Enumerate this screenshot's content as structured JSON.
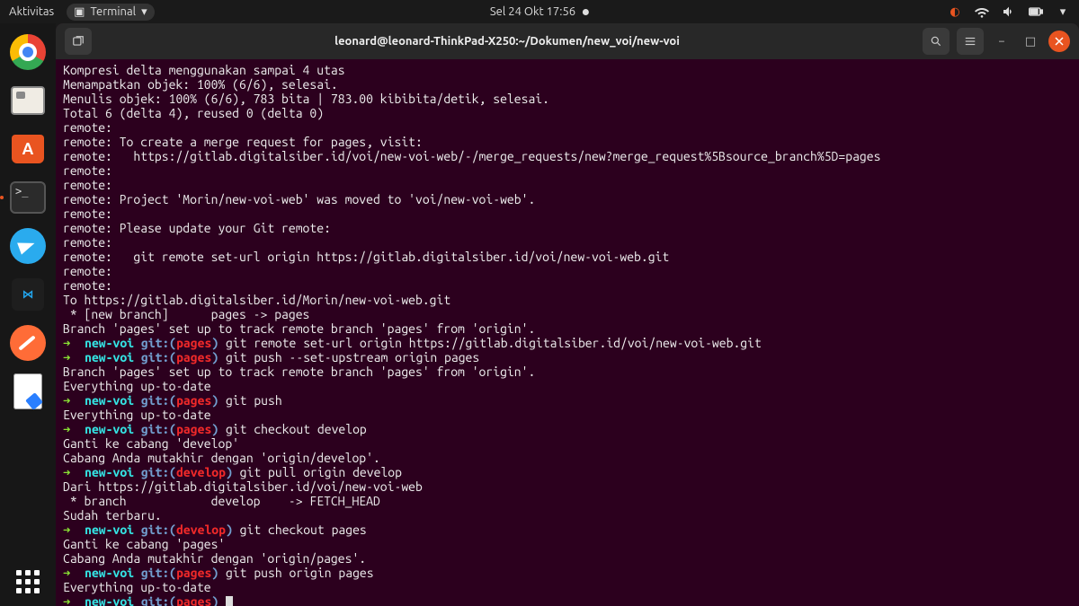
{
  "topbar": {
    "activities": "Aktivitas",
    "app_label": "Terminal",
    "datetime": "Sel 24 Okt  17:56"
  },
  "window": {
    "title": "leonard@leonard-ThinkPad-X250:~/Dokumen/new_voi/new-voi"
  },
  "colors": {
    "terminal_bg": "#2c001e",
    "ubuntu_orange": "#e95420",
    "prompt_dir": "#34e2e2",
    "prompt_git": "#729fcf",
    "prompt_branch": "#ef2929",
    "prompt_arrow": "#8ae234"
  },
  "prompt": {
    "arrow": "➜",
    "dir": "new-voi",
    "git_label": "git:"
  },
  "terminal": {
    "out": [
      "Kompresi delta menggunakan sampai 4 utas",
      "Memampatkan objek: 100% (6/6), selesai.",
      "Menulis objek: 100% (6/6), 783 bita | 783.00 kibibita/detik, selesai.",
      "Total 6 (delta 4), reused 0 (delta 0)",
      "remote: ",
      "remote: To create a merge request for pages, visit:",
      "remote:   https://gitlab.digitalsiber.id/voi/new-voi-web/-/merge_requests/new?merge_request%5Bsource_branch%5D=pages",
      "remote: ",
      "remote: ",
      "remote: Project 'Morin/new-voi-web' was moved to 'voi/new-voi-web'.",
      "remote: ",
      "remote: Please update your Git remote:",
      "remote: ",
      "remote:   git remote set-url origin https://gitlab.digitalsiber.id/voi/new-voi-web.git",
      "remote: ",
      "remote: ",
      "To https://gitlab.digitalsiber.id/Morin/new-voi-web.git",
      " * [new branch]      pages -> pages",
      "Branch 'pages' set up to track remote branch 'pages' from 'origin'."
    ],
    "cmd1": "git remote set-url origin https://gitlab.digitalsiber.id/voi/new-voi-web.git",
    "cmd2": "git push --set-upstream origin pages",
    "out2": [
      "Branch 'pages' set up to track remote branch 'pages' from 'origin'.",
      "Everything up-to-date"
    ],
    "cmd3": "git push",
    "out3": "Everything up-to-date",
    "cmd4": "git checkout develop",
    "out4": [
      "Ganti ke cabang 'develop'",
      "Cabang Anda mutakhir dengan 'origin/develop'."
    ],
    "branch_develop": "develop",
    "cmd5": "git pull origin develop",
    "out5": [
      "Dari https://gitlab.digitalsiber.id/voi/new-voi-web",
      " * branch            develop    -> FETCH_HEAD",
      "Sudah terbaru."
    ],
    "cmd6": "git checkout pages",
    "out6": [
      "Ganti ke cabang 'pages'",
      "Cabang Anda mutakhir dengan 'origin/pages'."
    ],
    "branch_pages": "pages",
    "cmd7": "git push origin pages",
    "out7": "Everything up-to-date"
  }
}
